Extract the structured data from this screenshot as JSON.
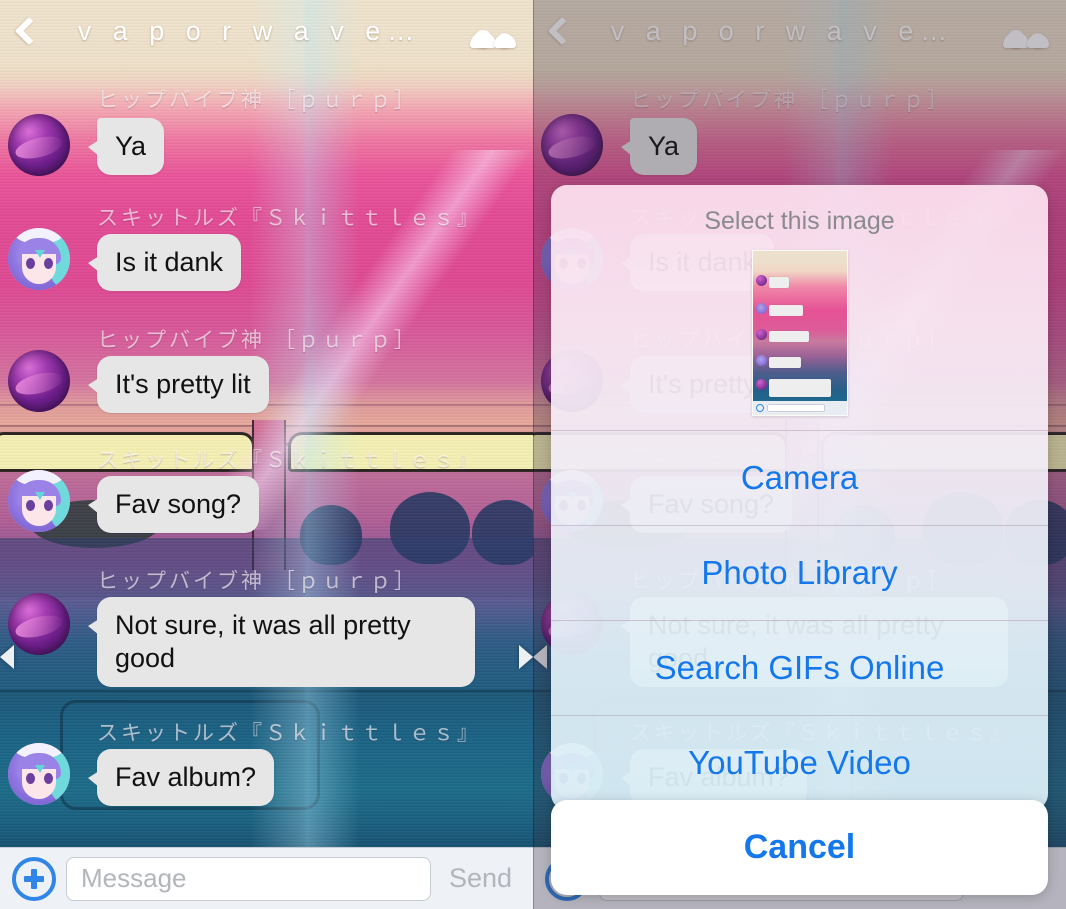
{
  "header": {
    "back_icon": "chevron-left-icon",
    "title": "v a p o r w a v e…",
    "group_icon": "group-members-icon"
  },
  "conversation": {
    "messages": [
      {
        "sender": "ヒップバイブ神 ［ｐｕｒｐ］",
        "text": "Ya",
        "avatar": "purp"
      },
      {
        "sender": "スキットルズ『Ｓｋｉｔｔｌｅｓ』",
        "text": "Is it dank",
        "avatar": "anime"
      },
      {
        "sender": "ヒップバイブ神 ［ｐｕｒｐ］",
        "text": "It's pretty lit",
        "avatar": "purp"
      },
      {
        "sender": "スキットルズ『Ｓｋｉｔｔｌｅｓ』",
        "text": "Fav song?",
        "avatar": "anime"
      },
      {
        "sender": "ヒップバイブ神 ［ｐｕｒｐ］",
        "text": "Not sure, it was all pretty good",
        "avatar": "purp"
      },
      {
        "sender": "スキットルズ『Ｓｋｉｔｔｌｅｓ』",
        "text": "Fav album?",
        "avatar": "anime"
      }
    ]
  },
  "input_bar": {
    "plus_icon": "add-attachment-icon",
    "placeholder": "Message",
    "value": "",
    "send_label": "Send"
  },
  "action_sheet": {
    "title": "Select this image",
    "thumbnail_name": "chat-screenshot-thumbnail",
    "options": [
      {
        "label": "Camera"
      },
      {
        "label": "Photo Library"
      },
      {
        "label": "Search GIFs Online"
      },
      {
        "label": "YouTube Video"
      }
    ],
    "cancel_label": "Cancel"
  },
  "colors": {
    "accent_blue": "#1478ec",
    "plus_blue": "#2f86e8",
    "bubble_gray": "#e6e6e6",
    "send_gray": "#b2b5ba",
    "sheet_title_gray": "#8a8a90"
  },
  "nav_arrows": {
    "left_icon": "scroll-left-arrow-icon",
    "right_icon": "scroll-right-arrow-icon"
  }
}
